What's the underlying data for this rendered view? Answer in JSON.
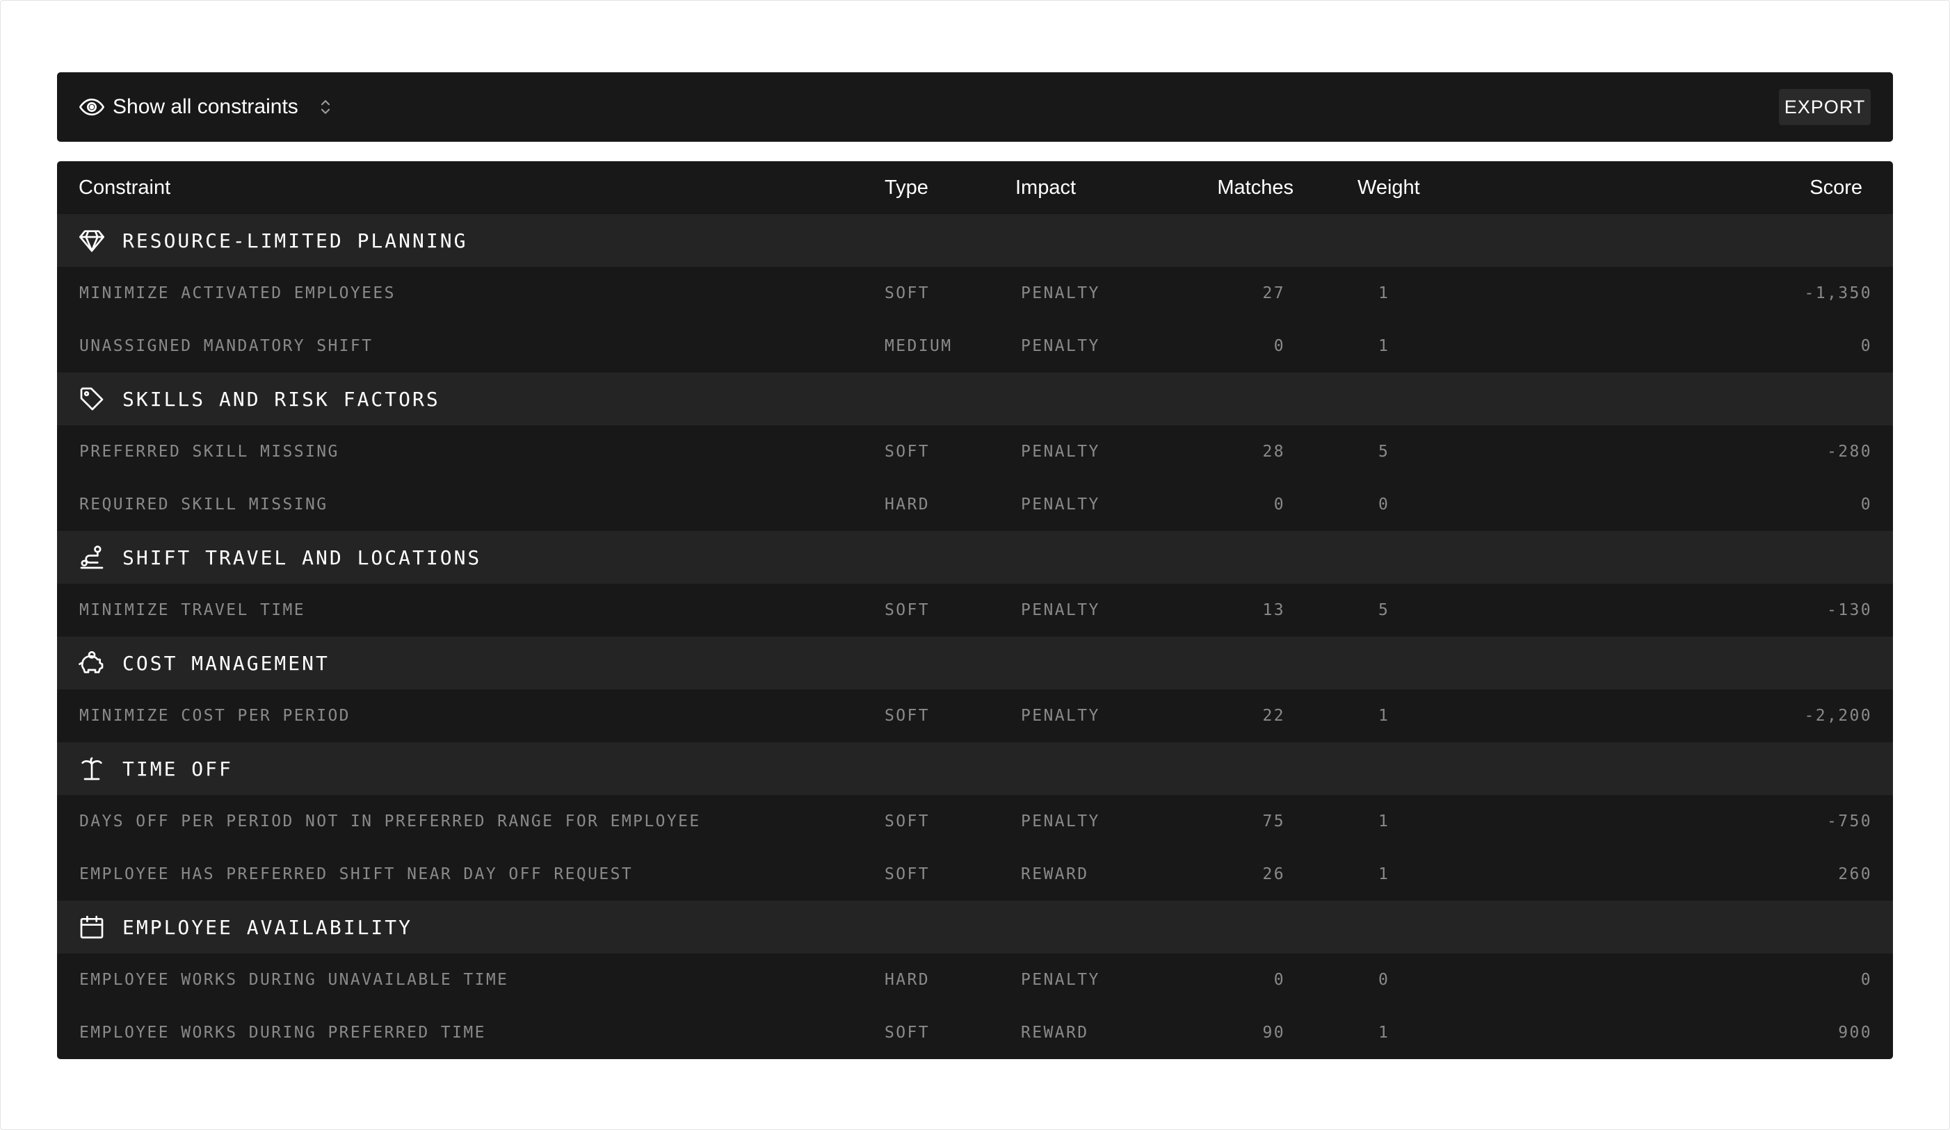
{
  "toolbar": {
    "filter_label": "Show all constraints",
    "export_label": "EXPORT"
  },
  "columns": {
    "constraint": "Constraint",
    "type": "Type",
    "impact": "Impact",
    "matches": "Matches",
    "weight": "Weight",
    "score": "Score"
  },
  "groups": [
    {
      "title": "RESOURCE-LIMITED PLANNING",
      "icon": "diamond-icon",
      "rows": [
        {
          "name": "MINIMIZE ACTIVATED EMPLOYEES",
          "type": "SOFT",
          "impact": "PENALTY",
          "matches": "27",
          "weight": "1",
          "score": "-1,350",
          "tone": "neg"
        },
        {
          "name": "UNASSIGNED MANDATORY SHIFT",
          "type": "MEDIUM",
          "impact": "PENALTY",
          "matches": "0",
          "weight": "1",
          "score": "0",
          "tone": "zero"
        }
      ]
    },
    {
      "title": "SKILLS AND RISK FACTORS",
      "icon": "tag-icon",
      "rows": [
        {
          "name": "PREFERRED SKILL MISSING",
          "type": "SOFT",
          "impact": "PENALTY",
          "matches": "28",
          "weight": "5",
          "score": "-280",
          "tone": "neg"
        },
        {
          "name": "REQUIRED SKILL MISSING",
          "type": "HARD",
          "impact": "PENALTY",
          "matches": "0",
          "weight": "0",
          "score": "0",
          "tone": "zero"
        }
      ]
    },
    {
      "title": "SHIFT TRAVEL AND LOCATIONS",
      "icon": "route-icon",
      "rows": [
        {
          "name": "MINIMIZE TRAVEL TIME",
          "type": "SOFT",
          "impact": "PENALTY",
          "matches": "13",
          "weight": "5",
          "score": "-130",
          "tone": "neg"
        }
      ]
    },
    {
      "title": "COST MANAGEMENT",
      "icon": "piggy-bank-icon",
      "rows": [
        {
          "name": "MINIMIZE COST PER PERIOD",
          "type": "SOFT",
          "impact": "PENALTY",
          "matches": "22",
          "weight": "1",
          "score": "-2,200",
          "tone": "neg"
        }
      ]
    },
    {
      "title": "TIME OFF",
      "icon": "palm-tree-icon",
      "rows": [
        {
          "name": "DAYS OFF PER PERIOD NOT IN PREFERRED RANGE FOR EMPLOYEE",
          "type": "SOFT",
          "impact": "PENALTY",
          "matches": "75",
          "weight": "1",
          "score": "-750",
          "tone": "neg"
        },
        {
          "name": "EMPLOYEE HAS PREFERRED SHIFT NEAR DAY OFF REQUEST",
          "type": "SOFT",
          "impact": "REWARD",
          "matches": "26",
          "weight": "1",
          "score": "260",
          "tone": "pos"
        }
      ]
    },
    {
      "title": "EMPLOYEE AVAILABILITY",
      "icon": "calendar-icon",
      "rows": [
        {
          "name": "EMPLOYEE WORKS DURING UNAVAILABLE TIME",
          "type": "HARD",
          "impact": "PENALTY",
          "matches": "0",
          "weight": "0",
          "score": "0",
          "tone": "zero"
        },
        {
          "name": "EMPLOYEE WORKS DURING PREFERRED TIME",
          "type": "SOFT",
          "impact": "REWARD",
          "matches": "90",
          "weight": "1",
          "score": "900",
          "tone": "pos"
        }
      ]
    }
  ]
}
